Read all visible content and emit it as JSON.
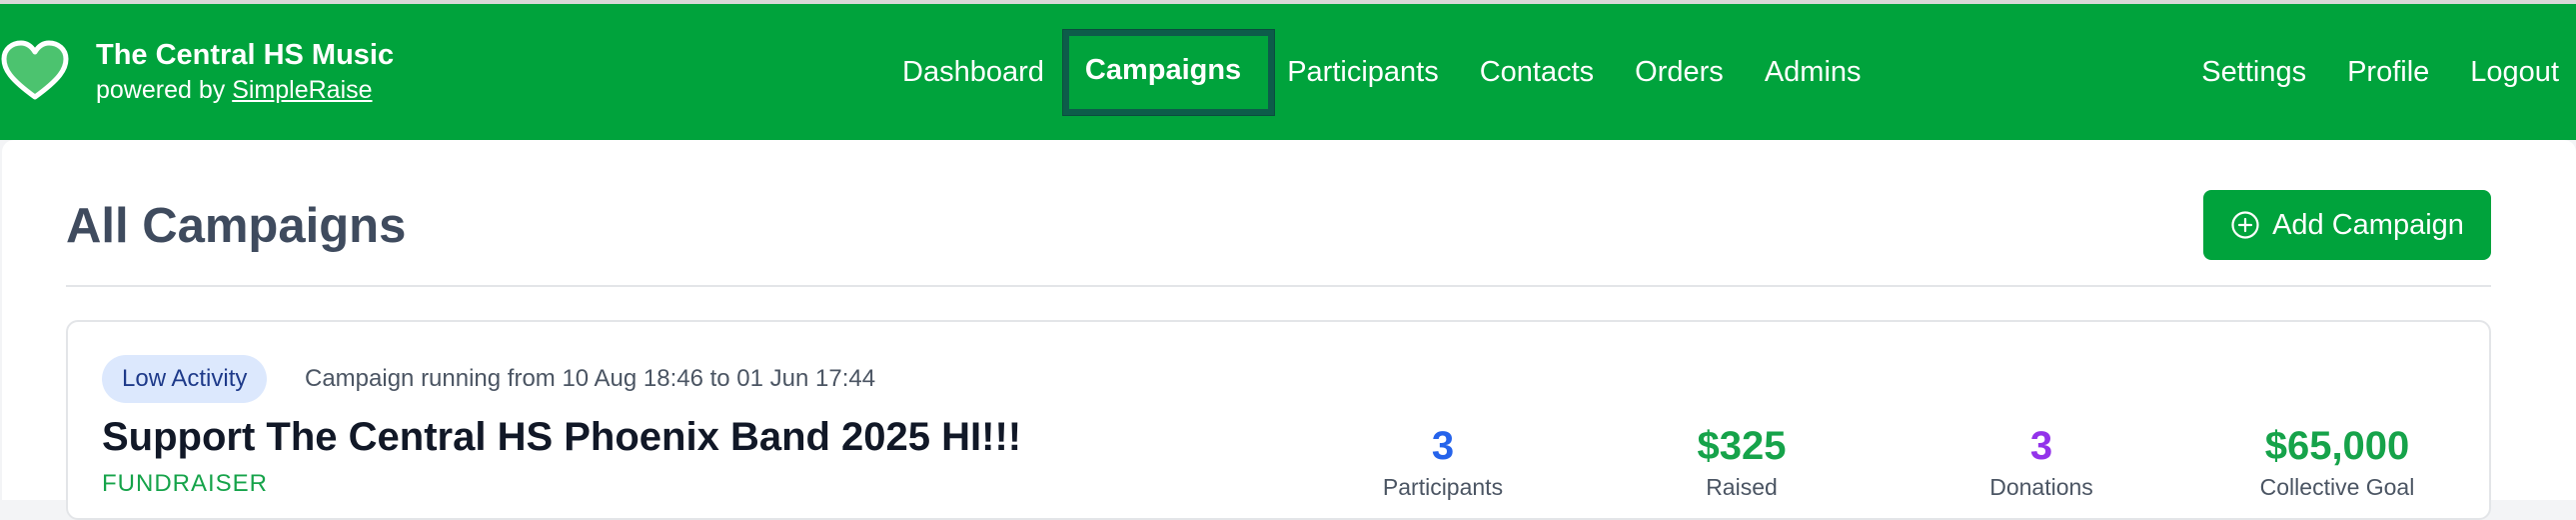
{
  "brand": {
    "name": "The Central HS Music",
    "powered_prefix": "powered by",
    "powered_link": "SimpleRaise"
  },
  "nav": {
    "main": [
      "Dashboard",
      "Campaigns",
      "Participants",
      "Contacts",
      "Orders",
      "Admins"
    ],
    "active": "Campaigns",
    "right": [
      "Settings",
      "Profile",
      "Logout"
    ]
  },
  "page": {
    "title": "All Campaigns",
    "add_button": "Add Campaign"
  },
  "campaign": {
    "badge": "Low Activity",
    "running": "Campaign running from 10 Aug 18:46 to 01 Jun 17:44",
    "title": "Support The Central HS Phoenix Band 2025 HI!!!",
    "type": "FUNDRAISER",
    "stats": [
      {
        "value": "3",
        "label": "Participants",
        "color": "#2563eb"
      },
      {
        "value": "$325",
        "label": "Raised",
        "color": "#16a34a"
      },
      {
        "value": "3",
        "label": "Donations",
        "color": "#9333ea"
      },
      {
        "value": "$65,000",
        "label": "Collective Goal",
        "color": "#16a34a"
      }
    ]
  },
  "colors": {
    "brand_green": "#00a33c",
    "active_outline": "#0d5c4a",
    "title_text": "#3f4b5e"
  },
  "icons": {
    "logo": "heart-icon",
    "add": "plus-circle-icon"
  }
}
